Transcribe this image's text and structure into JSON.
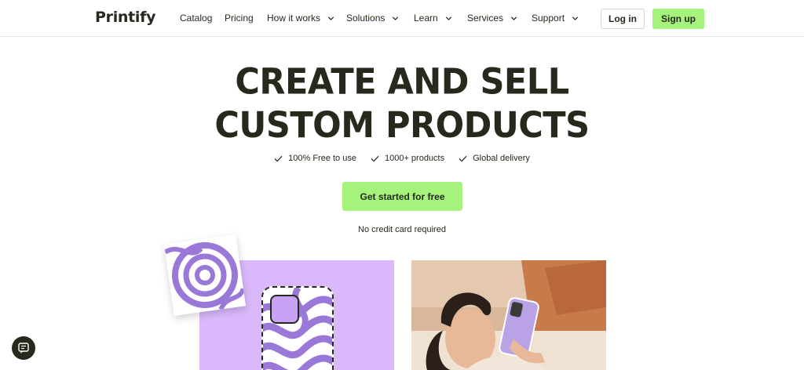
{
  "nav": {
    "logo": "Printify",
    "items": [
      {
        "label": "Catalog"
      },
      {
        "label": "Pricing"
      },
      {
        "label": "How it works"
      },
      {
        "label": "Solutions"
      },
      {
        "label": "Learn"
      },
      {
        "label": "Services"
      },
      {
        "label": "Support"
      }
    ],
    "login_label": "Log in",
    "signup_label": "Sign up"
  },
  "hero": {
    "title_line1": "CREATE AND SELL",
    "title_line2": "CUSTOM PRODUCTS",
    "features": [
      "100% Free to use",
      "1000+ products",
      "Global delivery"
    ],
    "cta_label": "Get started for free",
    "cta_note": "No credit card required"
  },
  "colors": {
    "accent": "#a5f37c",
    "text": "#26291b",
    "purple": "#d9b9fb",
    "wave": "#9a78d8"
  },
  "icons": {
    "check": "check-icon",
    "chevron": "chevron-down-icon",
    "chat": "chat-icon"
  }
}
